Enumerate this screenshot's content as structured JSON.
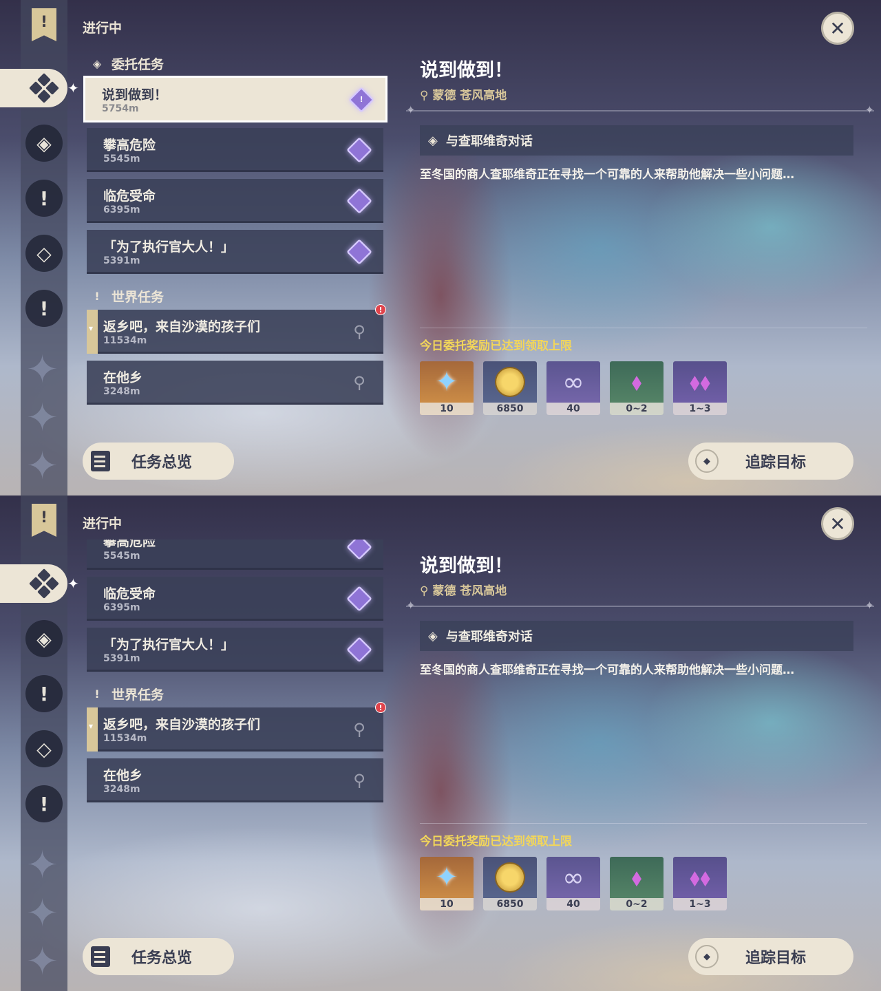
{
  "header": {
    "title": "进行中"
  },
  "sections": {
    "commission": "委托任务",
    "world": "世界任务"
  },
  "quests": [
    {
      "title": "说到做到！",
      "distance": "5754m"
    },
    {
      "title": "攀高危险",
      "distance": "5545m"
    },
    {
      "title": "临危受命",
      "distance": "6395m"
    },
    {
      "title": "「为了执行官大人！」",
      "distance": "5391m"
    },
    {
      "title": "返乡吧，来自沙漠的孩子们",
      "distance": "11534m"
    },
    {
      "title": "在他乡",
      "distance": "3248m"
    }
  ],
  "detail": {
    "title": "说到做到！",
    "location": "蒙德 苍风高地",
    "objective": "与查耶维奇对话",
    "description": "至冬国的商人查耶维奇正在寻找一个可靠的人来帮助他解决一些小问题…",
    "reward_notice": "今日委托奖励已达到领取上限",
    "rewards": [
      {
        "icon": "primogem-icon",
        "count": "10"
      },
      {
        "icon": "mora-icon",
        "count": "6850"
      },
      {
        "icon": "companionship-exp-icon",
        "count": "40"
      },
      {
        "icon": "crystal-icon",
        "count": "0~2"
      },
      {
        "icon": "crystal-cluster-icon",
        "count": "1~3"
      }
    ]
  },
  "buttons": {
    "overview": "任务总览",
    "track": "追踪目标"
  },
  "colors": {
    "accent_cream": "#ece5d6",
    "notice_yellow": "#f2d65a",
    "card_bg": "#3a4058",
    "location_gold": "#d8c79a"
  }
}
